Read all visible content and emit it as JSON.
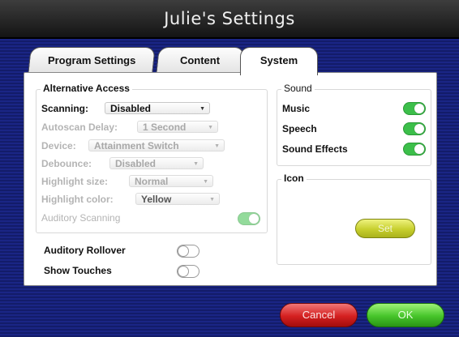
{
  "window": {
    "title": "Julie's Settings"
  },
  "tabs": [
    {
      "label": "Program Settings",
      "active": false
    },
    {
      "label": "Content",
      "active": false
    },
    {
      "label": "System",
      "active": true
    }
  ],
  "alt_access": {
    "title": "Alternative Access",
    "scanning": {
      "label": "Scanning:",
      "value": "Disabled"
    },
    "autoscan_delay": {
      "label": "Autoscan Delay:",
      "value": "1 Second"
    },
    "device": {
      "label": "Device:",
      "value": "Attainment Switch"
    },
    "debounce": {
      "label": "Debounce:",
      "value": "Disabled"
    },
    "highlight_size": {
      "label": "Highlight size:",
      "value": "Normal"
    },
    "highlight_color": {
      "label": "Highlight color:",
      "value": "Yellow"
    },
    "auditory_scanning": {
      "label": "Auditory Scanning",
      "on": true
    }
  },
  "extras": {
    "auditory_rollover": {
      "label": "Auditory Rollover",
      "on": false
    },
    "show_touches": {
      "label": "Show Touches",
      "on": false
    }
  },
  "sound": {
    "title": "Sound",
    "music": {
      "label": "Music",
      "on": true
    },
    "speech": {
      "label": "Speech",
      "on": true
    },
    "sound_effects": {
      "label": "Sound Effects",
      "on": true
    }
  },
  "icon": {
    "title": "Icon",
    "set_label": "Set"
  },
  "footer": {
    "cancel_label": "Cancel",
    "ok_label": "OK"
  },
  "colors": {
    "toggle_on": "#3cbf4a",
    "cancel": "#d42020",
    "ok": "#46c42a",
    "set": "#c7cf2e",
    "background": "#17217a"
  }
}
